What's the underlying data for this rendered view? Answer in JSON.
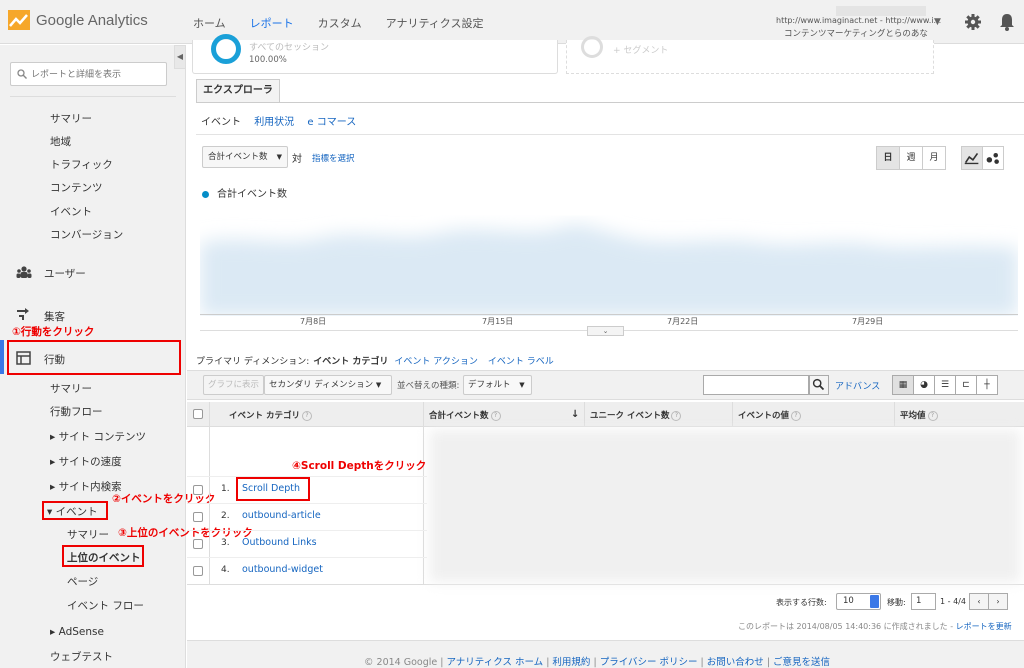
{
  "app": {
    "brand": "Google Analytics"
  },
  "topnav": {
    "items": [
      "ホーム",
      "レポート",
      "カスタム",
      "アナリティクス設定"
    ],
    "active_index": 1
  },
  "account": {
    "line1": "http://www.imaginact.net - http://www.i...",
    "line2": "コンテンツマーケティングとらのあな"
  },
  "sidebar": {
    "search_placeholder": "レポートと詳細を表示",
    "items": {
      "summary": "サマリー",
      "region": "地域",
      "traffic": "トラフィック",
      "contents": "コンテンツ",
      "event": "イベント",
      "conversion": "コンバージョン",
      "users": "ユーザー",
      "acquisition": "集客",
      "behavior": "行動",
      "b_summary": "サマリー",
      "b_flow": "行動フロー",
      "site_content": "▸ サイト コンテンツ",
      "site_speed": "▸ サイトの速度",
      "site_search": "▸ サイト内検索",
      "events": "▾ イベント",
      "e_summary": "サマリー",
      "e_top": "上位のイベント",
      "e_pages": "ページ",
      "e_flow": "イベント フロー",
      "adsense": "▸ AdSense",
      "webtest": "ウェブテスト"
    }
  },
  "annotations": {
    "a1": "①行動をクリック",
    "a2": "②イベントをクリック",
    "a3": "③上位のイベントをクリック",
    "a4": "④Scroll Depthをクリック"
  },
  "segments": {
    "seg1_name": "すべてのセッション",
    "seg1_pct": "100.00%",
    "seg2_name": "+ セグメント"
  },
  "tabs": {
    "explorer": "エクスプローラ"
  },
  "subtabs": {
    "current": "イベント",
    "usage": "利用状況",
    "ecommerce": "e コマース"
  },
  "chart_controls": {
    "metric": "合計イベント数",
    "vs": "対",
    "select_metric": "指標を選択",
    "day": "日",
    "week": "週",
    "month": "月"
  },
  "chart_data": {
    "type": "area",
    "series": [
      {
        "name": "合計イベント数",
        "color": "#058dc7"
      }
    ],
    "x_ticks": [
      "7月8日",
      "7月15日",
      "7月22日",
      "7月29日"
    ]
  },
  "dimensions": {
    "label": "プライマリ ディメンション:",
    "current": "イベント カテゴリ",
    "action": "イベント アクション",
    "event_label": "イベント ラベル"
  },
  "toolbar": {
    "plot_rows": "グラフに表示",
    "secondary": "セカンダリ ディメンション",
    "sort_label": "並べ替えの種類:",
    "sort_value": "デフォルト",
    "advanced": "アドバンス"
  },
  "table": {
    "headers": {
      "category": "イベント カテゴリ",
      "total": "合計イベント数",
      "unique": "ユニーク イベント数",
      "value": "イベントの値",
      "avg": "平均値"
    },
    "rows": [
      {
        "num": "1.",
        "label": "Scroll Depth"
      },
      {
        "num": "2.",
        "label": "outbound-article"
      },
      {
        "num": "3.",
        "label": "Outbound Links"
      },
      {
        "num": "4.",
        "label": "outbound-widget"
      }
    ]
  },
  "pagination": {
    "rows_label": "表示する行数:",
    "rows_value": "10",
    "goto_label": "移動:",
    "goto_value": "1",
    "range": "1 - 4/4"
  },
  "created": {
    "text": "このレポートは 2014/08/05 14:40:36 に作成されました - ",
    "refresh": "レポートを更新"
  },
  "footer": {
    "copyright": "© 2014 Google | ",
    "home": "アナリティクス ホーム",
    "terms": "利用規約",
    "privacy": "プライバシー ポリシー",
    "contact": "お問い合わせ",
    "feedback": "ご意見を送信",
    "sep": " | "
  }
}
